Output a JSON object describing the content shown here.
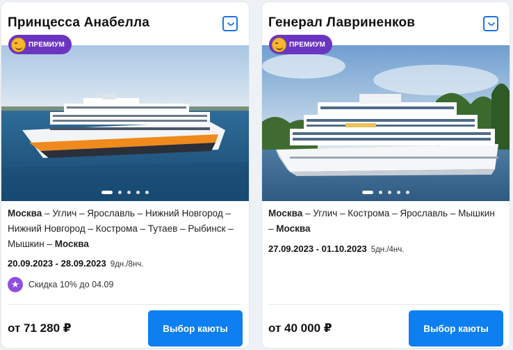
{
  "cards": [
    {
      "title": "Принцесса Анабелла",
      "badge": "ПРЕМИУМ",
      "route": {
        "start": "Москва",
        "middle": " – Углич – Ярославль – Нижний Новгород – Нижний Новгород – Кострома – Тутаев – Рыбинск – Мышкин – ",
        "end": "Москва"
      },
      "dates": "20.09.2023 - 28.09.2023",
      "duration": "9дн./8нч.",
      "discount": "Скидка 10% до 04.09",
      "price_prefix": "от",
      "price": "71 280 ₽",
      "cta": "Выбор каюты",
      "gallery_total": 5,
      "gallery_active": 1
    },
    {
      "title": "Генерал Лавриненков",
      "badge": "ПРЕМИУМ",
      "route": {
        "start": "Москва",
        "middle": " – Углич – Кострома – Ярославль – Мышкин – ",
        "end": "Москва"
      },
      "dates": "27.09.2023 - 01.10.2023",
      "duration": "5дн./4нч.",
      "price_prefix": "от",
      "price": "40 000 ₽",
      "cta": "Выбор каюты",
      "gallery_total": 5,
      "gallery_active": 1
    }
  ],
  "colors": {
    "accent": "#0d7ff0",
    "badge": "#6a35c0",
    "discount": "#8e4fe0",
    "river": "#1f5c8e",
    "hull_stripe": "#f08a1c"
  },
  "icons": {
    "favorite": "bag-icon",
    "badge": "smile-icon",
    "discount": "star-icon"
  }
}
